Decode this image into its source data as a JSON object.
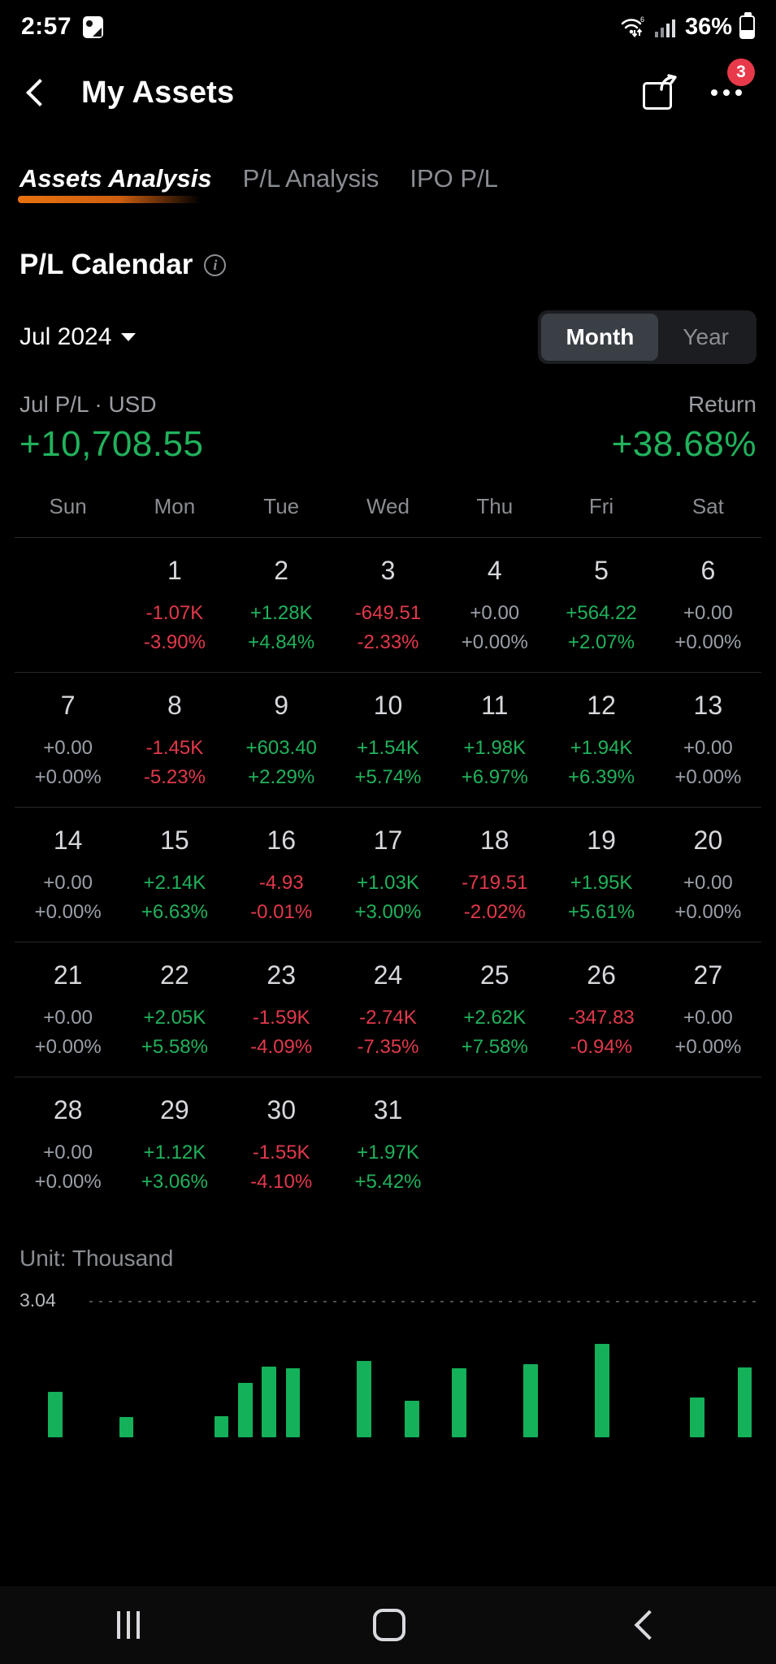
{
  "status_bar": {
    "time": "2:57",
    "image_icon": "image-icon",
    "wifi_icon": "wifi-icon",
    "signal_icon": "cellular-signal-icon",
    "battery_percent": "36%",
    "battery_icon": "battery-icon"
  },
  "app_bar": {
    "back_icon": "back-chevron-icon",
    "title": "My Assets",
    "share_icon": "share-icon",
    "more_icon": "more-options-icon",
    "notification_badge": "3"
  },
  "tabs": [
    {
      "label": "Assets Analysis",
      "active": true
    },
    {
      "label": "P/L Analysis",
      "active": false
    },
    {
      "label": "IPO P/L",
      "active": false
    }
  ],
  "section": {
    "title": "P/L Calendar",
    "info_icon": "info-icon",
    "info_glyph": "i"
  },
  "month_selector": {
    "label": "Jul 2024",
    "caret_icon": "chevron-down-icon",
    "segments": [
      {
        "label": "Month",
        "active": true
      },
      {
        "label": "Year",
        "active": false
      }
    ]
  },
  "summary": {
    "pl_label": "Jul P/L · USD",
    "pl_value": "+10,708.55",
    "return_label": "Return",
    "return_value": "+38.68%"
  },
  "calendar": {
    "weekday_headers": [
      "Sun",
      "Mon",
      "Tue",
      "Wed",
      "Thu",
      "Fri",
      "Sat"
    ],
    "weeks": [
      [
        {
          "day": "",
          "amount": "",
          "percent": "",
          "state": "empty"
        },
        {
          "day": "1",
          "amount": "-1.07K",
          "percent": "-3.90%",
          "state": "neg"
        },
        {
          "day": "2",
          "amount": "+1.28K",
          "percent": "+4.84%",
          "state": "pos"
        },
        {
          "day": "3",
          "amount": "-649.51",
          "percent": "-2.33%",
          "state": "neg"
        },
        {
          "day": "4",
          "amount": "+0.00",
          "percent": "+0.00%",
          "state": "zero"
        },
        {
          "day": "5",
          "amount": "+564.22",
          "percent": "+2.07%",
          "state": "pos"
        },
        {
          "day": "6",
          "amount": "+0.00",
          "percent": "+0.00%",
          "state": "zero"
        }
      ],
      [
        {
          "day": "7",
          "amount": "+0.00",
          "percent": "+0.00%",
          "state": "zero"
        },
        {
          "day": "8",
          "amount": "-1.45K",
          "percent": "-5.23%",
          "state": "neg"
        },
        {
          "day": "9",
          "amount": "+603.40",
          "percent": "+2.29%",
          "state": "pos"
        },
        {
          "day": "10",
          "amount": "+1.54K",
          "percent": "+5.74%",
          "state": "pos"
        },
        {
          "day": "11",
          "amount": "+1.98K",
          "percent": "+6.97%",
          "state": "pos"
        },
        {
          "day": "12",
          "amount": "+1.94K",
          "percent": "+6.39%",
          "state": "pos"
        },
        {
          "day": "13",
          "amount": "+0.00",
          "percent": "+0.00%",
          "state": "zero"
        }
      ],
      [
        {
          "day": "14",
          "amount": "+0.00",
          "percent": "+0.00%",
          "state": "zero"
        },
        {
          "day": "15",
          "amount": "+2.14K",
          "percent": "+6.63%",
          "state": "pos"
        },
        {
          "day": "16",
          "amount": "-4.93",
          "percent": "-0.01%",
          "state": "neg"
        },
        {
          "day": "17",
          "amount": "+1.03K",
          "percent": "+3.00%",
          "state": "pos"
        },
        {
          "day": "18",
          "amount": "-719.51",
          "percent": "-2.02%",
          "state": "neg"
        },
        {
          "day": "19",
          "amount": "+1.95K",
          "percent": "+5.61%",
          "state": "pos"
        },
        {
          "day": "20",
          "amount": "+0.00",
          "percent": "+0.00%",
          "state": "zero"
        }
      ],
      [
        {
          "day": "21",
          "amount": "+0.00",
          "percent": "+0.00%",
          "state": "zero"
        },
        {
          "day": "22",
          "amount": "+2.05K",
          "percent": "+5.58%",
          "state": "pos"
        },
        {
          "day": "23",
          "amount": "-1.59K",
          "percent": "-4.09%",
          "state": "neg"
        },
        {
          "day": "24",
          "amount": "-2.74K",
          "percent": "-7.35%",
          "state": "neg"
        },
        {
          "day": "25",
          "amount": "+2.62K",
          "percent": "+7.58%",
          "state": "pos"
        },
        {
          "day": "26",
          "amount": "-347.83",
          "percent": "-0.94%",
          "state": "neg"
        },
        {
          "day": "27",
          "amount": "+0.00",
          "percent": "+0.00%",
          "state": "zero"
        }
      ],
      [
        {
          "day": "28",
          "amount": "+0.00",
          "percent": "+0.00%",
          "state": "zero"
        },
        {
          "day": "29",
          "amount": "+1.12K",
          "percent": "+3.06%",
          "state": "pos"
        },
        {
          "day": "30",
          "amount": "-1.55K",
          "percent": "-4.10%",
          "state": "neg"
        },
        {
          "day": "31",
          "amount": "+1.97K",
          "percent": "+5.42%",
          "state": "pos"
        },
        {
          "day": "",
          "amount": "",
          "percent": "",
          "state": "empty"
        },
        {
          "day": "",
          "amount": "",
          "percent": "",
          "state": "empty"
        },
        {
          "day": "",
          "amount": "",
          "percent": "",
          "state": "empty"
        }
      ]
    ]
  },
  "chart_section": {
    "unit_label": "Unit: Thousand",
    "axis_value": "3.04"
  },
  "chart_data": {
    "type": "bar",
    "title": "Daily P/L",
    "xlabel": "",
    "ylabel": "Unit: Thousand",
    "ylim": [
      0,
      3.04
    ],
    "grid": true,
    "legend": "none",
    "categories": [
      "1",
      "2",
      "3",
      "4",
      "5",
      "6",
      "7",
      "8",
      "9",
      "10",
      "11",
      "12",
      "13",
      "14",
      "15",
      "16",
      "17",
      "18",
      "19",
      "20",
      "21",
      "22",
      "23",
      "24",
      "25",
      "26",
      "27",
      "28",
      "29",
      "30",
      "31"
    ],
    "values": [
      -1.07,
      1.28,
      -0.65,
      0.0,
      0.56,
      0.0,
      0.0,
      -1.45,
      0.6,
      1.54,
      1.98,
      1.94,
      0.0,
      0.0,
      2.14,
      -0.005,
      1.03,
      -0.72,
      1.95,
      0.0,
      0.0,
      2.05,
      -1.59,
      -2.74,
      2.62,
      -0.35,
      0.0,
      0.0,
      1.12,
      -1.55,
      1.97
    ],
    "visible_window_note": "only the top of the bar chart is visible; bars shown are clipped at the viewport bottom"
  },
  "nav_bar": {
    "recent_icon": "recent-apps-icon",
    "home_icon": "home-icon",
    "back_icon": "back-icon"
  },
  "colors": {
    "positive": "#21b25c",
    "negative": "#e2394b",
    "neutral": "#9aa0a8",
    "accent": "#e8720f",
    "badge": "#e8394a",
    "background": "#000000"
  }
}
